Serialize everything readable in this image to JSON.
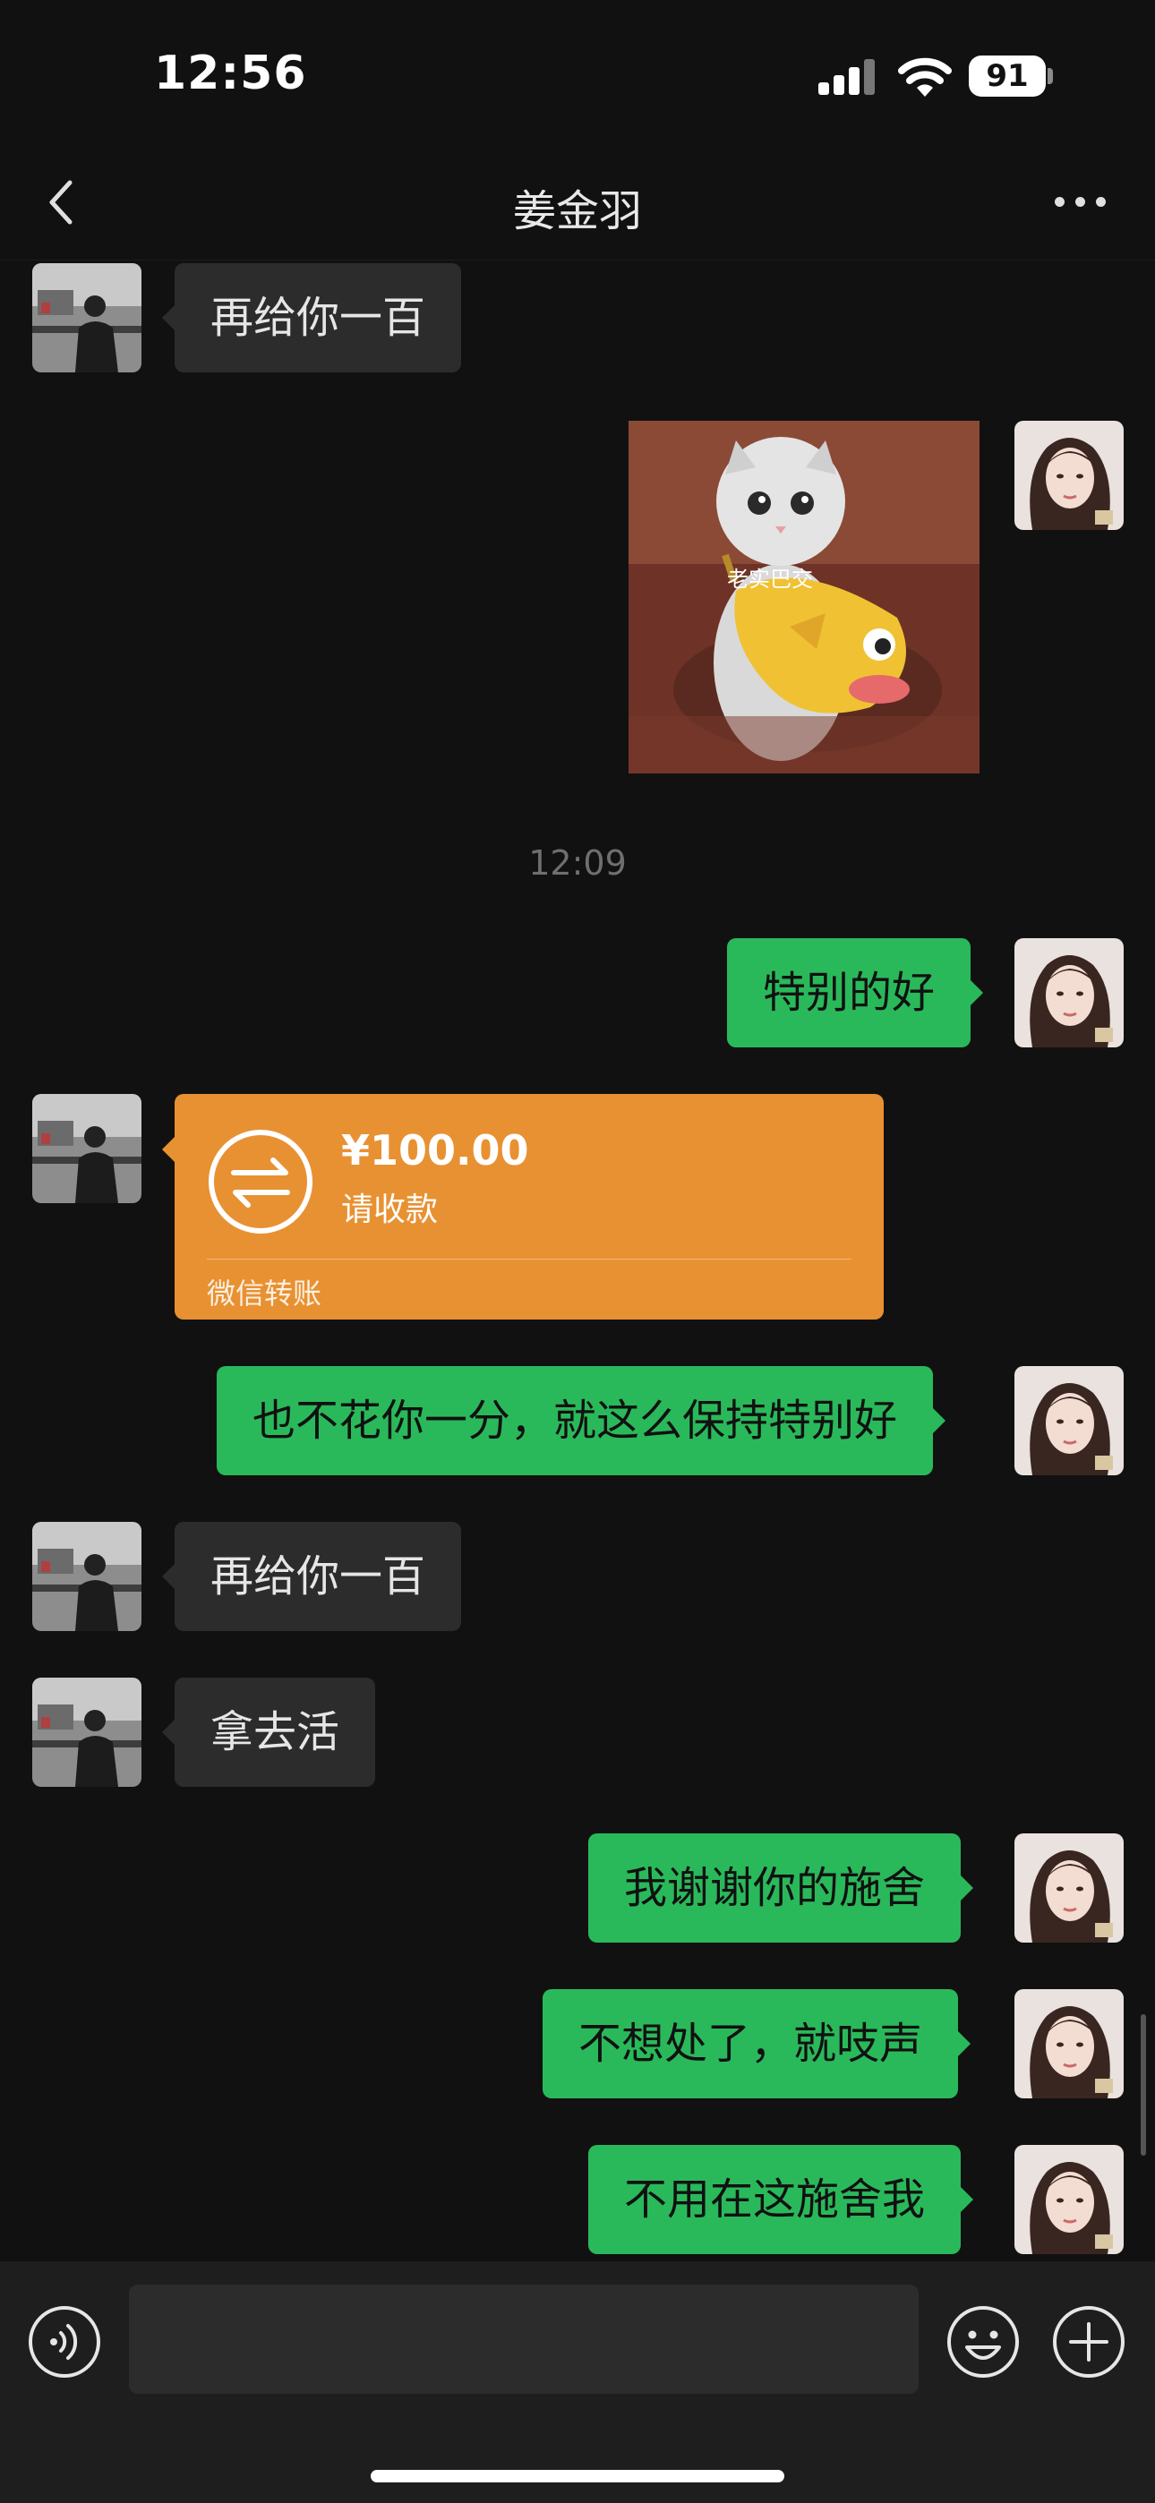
{
  "status_bar": {
    "time": "12:56",
    "battery": "91"
  },
  "nav": {
    "title": "姜金羽"
  },
  "chat": {
    "messages": [
      {
        "side": "in",
        "text": "再给你一百"
      },
      {
        "side": "out",
        "type": "sticker",
        "sticker_caption": "老实巴交"
      },
      {
        "type": "timestamp",
        "text": "12:09"
      },
      {
        "side": "out",
        "text": "特别的好"
      },
      {
        "side": "in",
        "type": "transfer",
        "amount": "¥100.00",
        "status": "请收款",
        "footer": "微信转账"
      },
      {
        "side": "out",
        "text": "也不花你一分，就这么保持特别好"
      },
      {
        "side": "in",
        "text": "再给你一百"
      },
      {
        "side": "in",
        "text": "拿去活"
      },
      {
        "side": "out",
        "text": "我谢谢你的施舍"
      },
      {
        "side": "out",
        "text": "不想处了，就吱声"
      },
      {
        "side": "out",
        "text": "不用在这施舍我"
      }
    ]
  },
  "input_bar": {
    "placeholder": ""
  },
  "colors": {
    "background": "#111111",
    "incoming_bubble": "#2c2c2c",
    "outgoing_bubble": "#2ab95a",
    "transfer_card": "#e89132"
  },
  "icons": [
    "back-icon",
    "more-icon",
    "voice-icon",
    "emoji-icon",
    "plus-icon",
    "transfer-icon"
  ]
}
